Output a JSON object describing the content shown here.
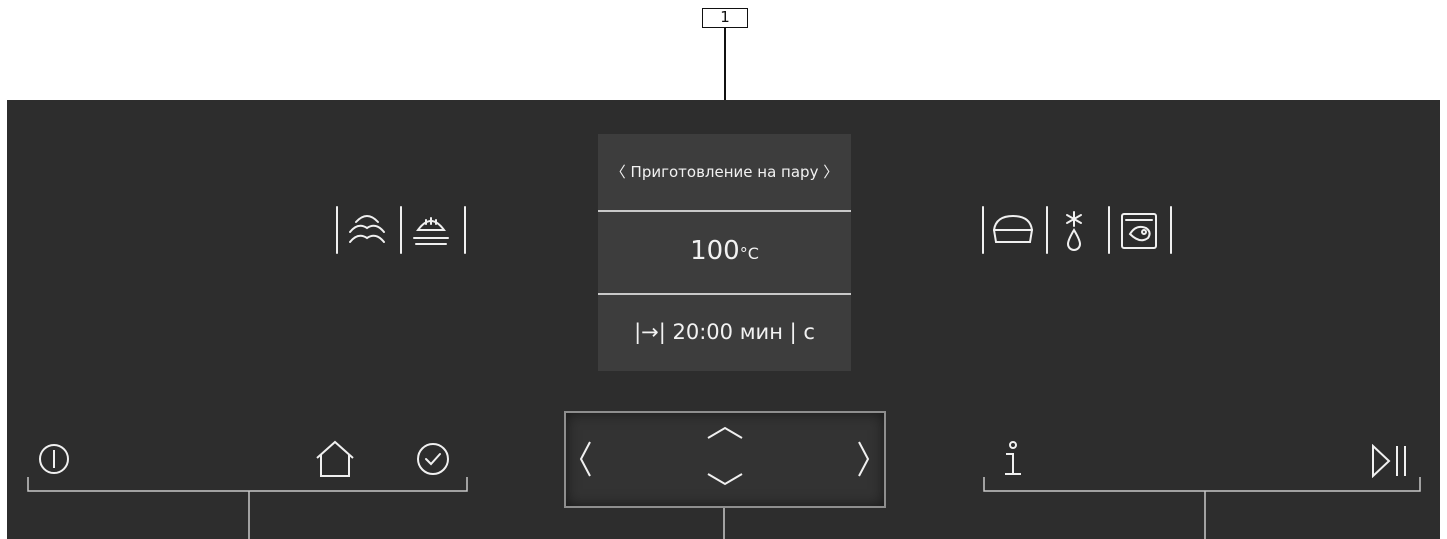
{
  "callout": {
    "number": "1"
  },
  "display": {
    "mode_prev": "〈",
    "mode_label": "Приготовление на пару",
    "mode_next": "〉",
    "temperature_value": "100",
    "temperature_unit": "°C",
    "timer_symbol": "|→|",
    "timer_value": "20:00",
    "timer_unit": "мин | с"
  },
  "icons_left": [
    "steam-icon",
    "steam-dish-icon"
  ],
  "icons_right": [
    "dish-cover-icon",
    "defrost-icon",
    "food-bag-icon"
  ],
  "controls_left": [
    "power-icon",
    "home-icon",
    "clock-icon"
  ],
  "controls_nav": [
    "chevron-left-icon",
    "chevron-up-icon",
    "chevron-down-icon",
    "chevron-right-icon"
  ],
  "controls_right": [
    "info-icon",
    "play-pause-icon"
  ],
  "colors": {
    "panel": "#2d2d2d",
    "display": "#3d3d3d",
    "text": "#f2f2f2",
    "lines": "#c8c8c8"
  }
}
